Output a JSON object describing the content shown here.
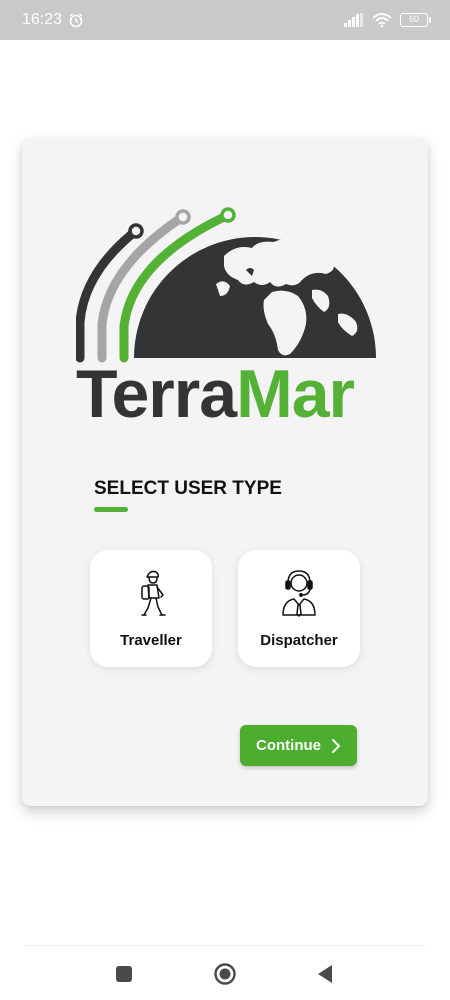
{
  "status_bar": {
    "time": "16:23",
    "battery_level": "60",
    "icons": [
      "alarm-icon",
      "signal-icon",
      "wifi-icon",
      "battery-icon"
    ]
  },
  "brand": {
    "name_part1": "Terra",
    "name_part2": "Mar",
    "colors": {
      "dark": "#333436",
      "green": "#53b135",
      "gray": "#a5a5a7"
    }
  },
  "user_type": {
    "title": "SELECT USER TYPE",
    "options": [
      {
        "label": "Traveller",
        "icon": "hiker-icon"
      },
      {
        "label": "Dispatcher",
        "icon": "headset-agent-icon"
      }
    ]
  },
  "actions": {
    "continue_label": "Continue",
    "accent": "#4cad2f"
  },
  "nav_bar": {
    "buttons": [
      "recents-square-icon",
      "home-circle-icon",
      "back-triangle-icon"
    ]
  }
}
